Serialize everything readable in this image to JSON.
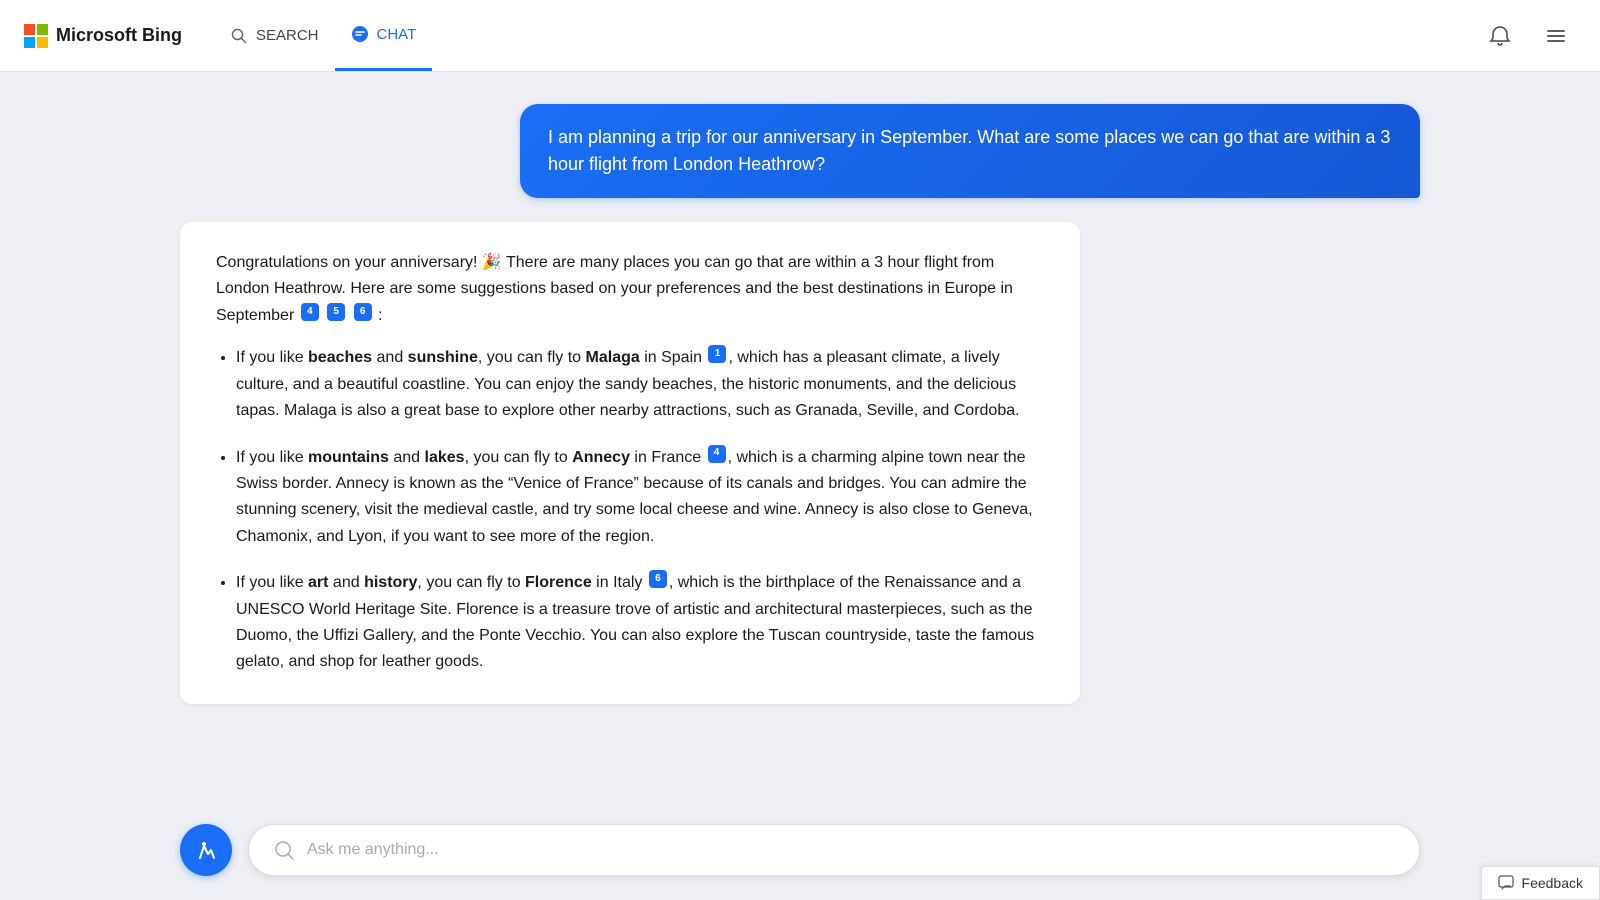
{
  "header": {
    "logo_text": "Microsoft Bing",
    "nav": [
      {
        "id": "search",
        "label": "SEARCH",
        "active": false
      },
      {
        "id": "chat",
        "label": "CHAT",
        "active": true
      }
    ]
  },
  "chat": {
    "user_message": "I am planning a trip for our anniversary in September. What are some places we can go that are within a 3 hour flight from London Heathrow?",
    "ai_intro": "Congratulations on your anniversary! 🎉 There are many places you can go that are within a 3 hour flight from London Heathrow. Here are some suggestions based on your preferences and the best destinations in Europe in September",
    "ai_intro_citations": [
      "4",
      "5",
      "6"
    ],
    "ai_intro_end": ":",
    "bullet_items": [
      {
        "prefix": "If you like ",
        "bold1": "beaches",
        "mid1": " and ",
        "bold2": "sunshine",
        "mid2": ", you can fly to ",
        "bold3": "Malaga",
        "mid3": " in Spain",
        "citation": "1",
        "rest": ", which has a pleasant climate, a lively culture, and a beautiful coastline. You can enjoy the sandy beaches, the historic monuments, and the delicious tapas. Malaga is also a great base to explore other nearby attractions, such as Granada, Seville, and Cordoba."
      },
      {
        "prefix": "If you like ",
        "bold1": "mountains",
        "mid1": " and ",
        "bold2": "lakes",
        "mid2": ", you can fly to ",
        "bold3": "Annecy",
        "mid3": " in France",
        "citation": "4",
        "rest": ", which is a charming alpine town near the Swiss border. Annecy is known as the “Venice of France” because of its canals and bridges. You can admire the stunning scenery, visit the medieval castle, and try some local cheese and wine. Annecy is also close to Geneva, Chamonix, and Lyon, if you want to see more of the region."
      },
      {
        "prefix": "If you like ",
        "bold1": "art",
        "mid1": " and ",
        "bold2": "history",
        "mid2": ", you can fly to ",
        "bold3": "Florence",
        "mid3": " in Italy",
        "citation": "6",
        "rest": ", which is the birthplace of the Renaissance and a UNESCO World Heritage Site. Florence is a treasure trove of artistic and architectural masterpieces, such as the Duomo, the Uffizi Gallery, and the Ponte Vecchio. You can also explore the Tuscan countryside, taste the famous gelato, and shop for leather goods."
      }
    ]
  },
  "input": {
    "placeholder": "Ask me anything..."
  },
  "feedback": {
    "label": "Feedback"
  }
}
